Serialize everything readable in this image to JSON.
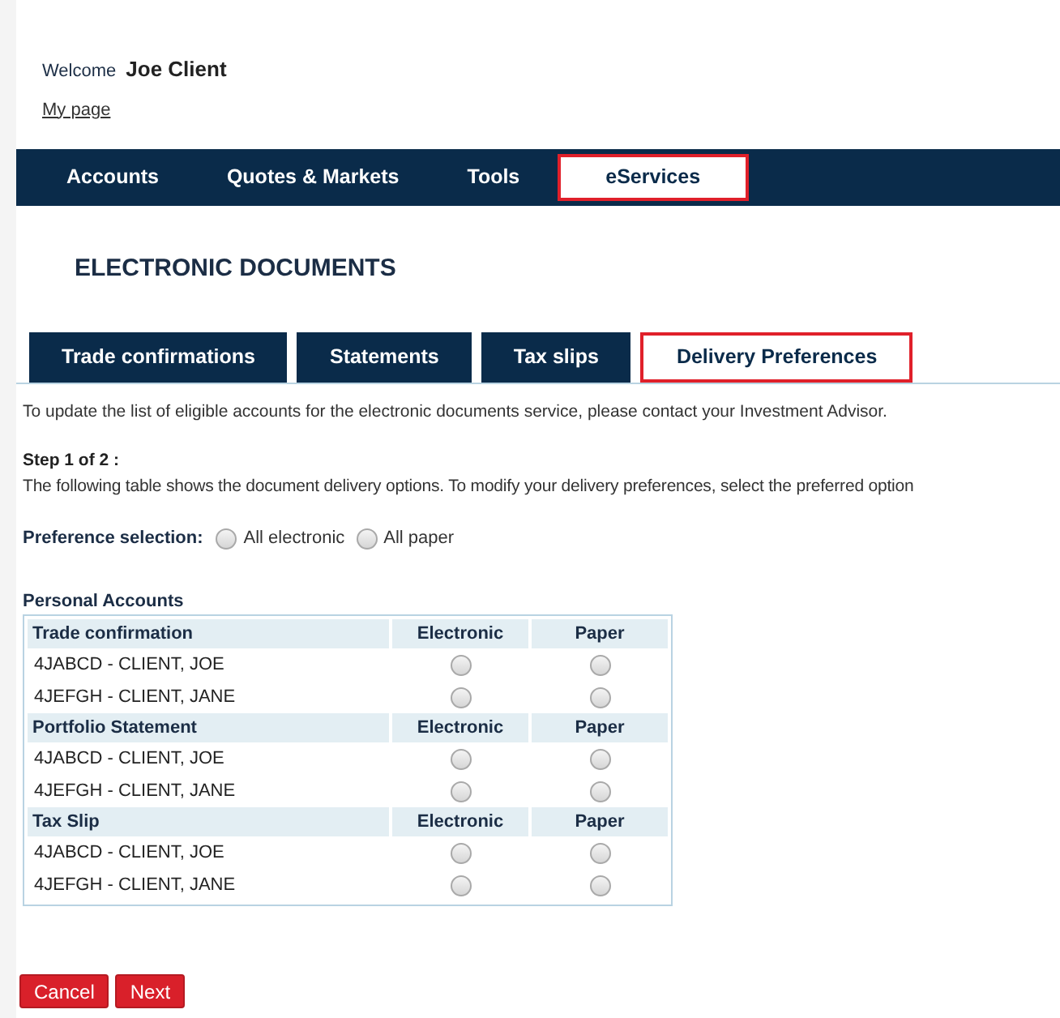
{
  "header": {
    "welcome": "Welcome",
    "user": "Joe Client",
    "link": "My page"
  },
  "nav": [
    {
      "label": "Accounts",
      "selected": false
    },
    {
      "label": "Quotes & Markets",
      "selected": false
    },
    {
      "label": "Tools",
      "selected": false
    },
    {
      "label": "eServices",
      "selected": true
    }
  ],
  "title": "ELECTRONIC DOCUMENTS",
  "tabs": [
    {
      "label": "Trade confirmations",
      "selected": false
    },
    {
      "label": "Statements",
      "selected": false
    },
    {
      "label": "Tax slips",
      "selected": false
    },
    {
      "label": "Delivery Preferences",
      "selected": true
    }
  ],
  "info": "To update the list of eligible accounts for the electronic documents service, please contact your Investment Advisor.",
  "step": {
    "title": "Step 1 of 2 :",
    "text": "The following table shows the document delivery options. To modify your delivery preferences, select the preferred option"
  },
  "preference": {
    "label": "Preference selection:",
    "options": [
      {
        "label": "All electronic",
        "selected": false
      },
      {
        "label": "All paper",
        "selected": false
      }
    ]
  },
  "section_title": "Personal Accounts",
  "groups": [
    {
      "name": "Trade confirmation",
      "col_1": "Electronic",
      "col_2": "Paper",
      "rows": [
        {
          "account": "4JABCD - CLIENT, JOE",
          "electronic": false,
          "paper": false
        },
        {
          "account": "4JEFGH - CLIENT, JANE",
          "electronic": false,
          "paper": false
        }
      ]
    },
    {
      "name": "Portfolio Statement",
      "col_1": "Electronic",
      "col_2": "Paper",
      "rows": [
        {
          "account": "4JABCD - CLIENT, JOE",
          "electronic": false,
          "paper": false
        },
        {
          "account": "4JEFGH - CLIENT, JANE",
          "electronic": false,
          "paper": false
        }
      ]
    },
    {
      "name": "Tax Slip",
      "col_1": "Electronic",
      "col_2": "Paper",
      "rows": [
        {
          "account": "4JABCD - CLIENT, JOE",
          "electronic": false,
          "paper": false
        },
        {
          "account": "4JEFGH - CLIENT, JANE",
          "electronic": false,
          "paper": false
        }
      ]
    }
  ],
  "buttons": [
    "Cancel",
    "Next"
  ]
}
